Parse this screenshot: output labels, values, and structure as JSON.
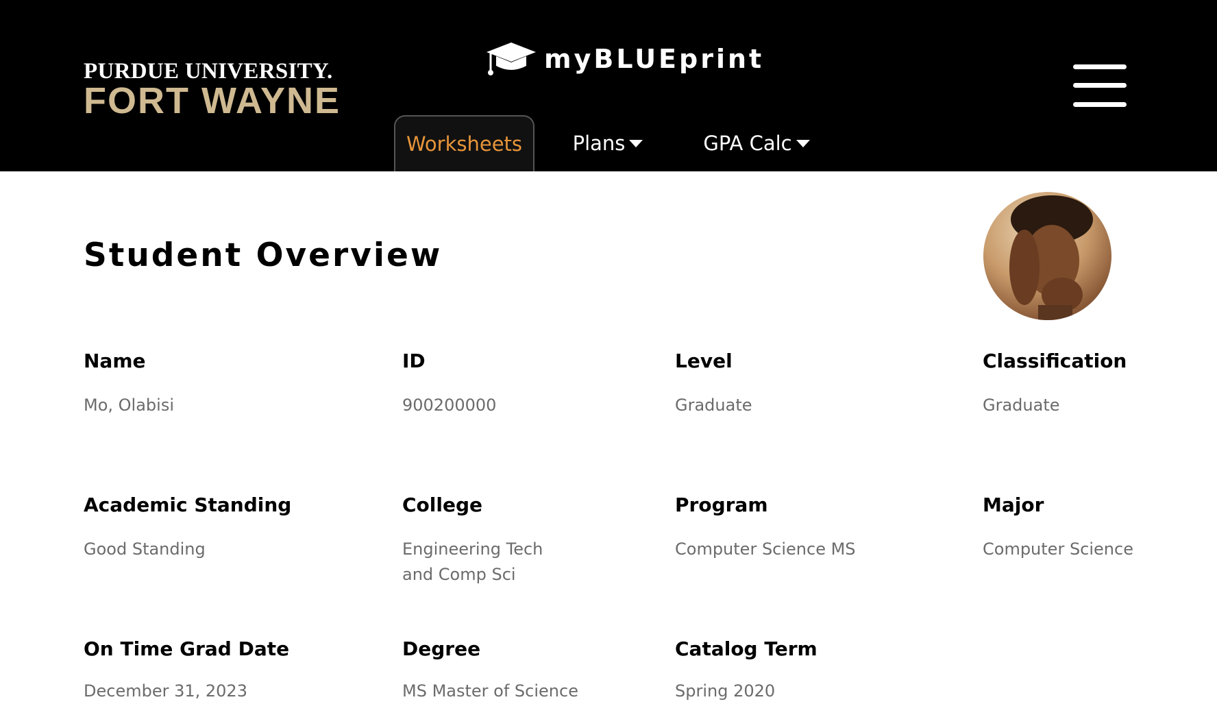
{
  "header": {
    "logo_line1": "PURDUE UNIVERSITY.",
    "logo_line2": "FORT WAYNE",
    "brand_name": "myBLUEprint",
    "brand_icon": "graduation-cap-icon",
    "menu_icon": "hamburger-menu-icon"
  },
  "nav": {
    "tabs": [
      {
        "label": "Worksheets",
        "active": true
      },
      {
        "label": "Plans",
        "dropdown": true
      },
      {
        "label": "GPA Calc",
        "dropdown": true
      }
    ]
  },
  "colors": {
    "header_bg": "#000000",
    "gold": "#cfb991",
    "active_tab": "#e8953a",
    "value_text": "#6b6b6b"
  },
  "page": {
    "title": "Student Overview"
  },
  "fields": {
    "name": {
      "label": "Name",
      "value": "Mo, Olabisi"
    },
    "id": {
      "label": "ID",
      "value": "900200000"
    },
    "level": {
      "label": "Level",
      "value": "Graduate"
    },
    "classification": {
      "label": "Classification",
      "value": "Graduate"
    },
    "academic_standing": {
      "label": "Academic Standing",
      "value": "Good Standing"
    },
    "college": {
      "label": "College",
      "value_line1": "Engineering Tech",
      "value_line2": "and Comp Sci"
    },
    "program": {
      "label": "Program",
      "value": "Computer Science MS"
    },
    "major": {
      "label": "Major",
      "value": "Computer Science"
    },
    "on_time_grad_date": {
      "label": "On Time Grad Date",
      "value": "December 31, 2023"
    },
    "degree": {
      "label": "Degree",
      "value": "MS Master of Science"
    },
    "catalog_term": {
      "label": "Catalog Term",
      "value": "Spring 2020"
    }
  }
}
